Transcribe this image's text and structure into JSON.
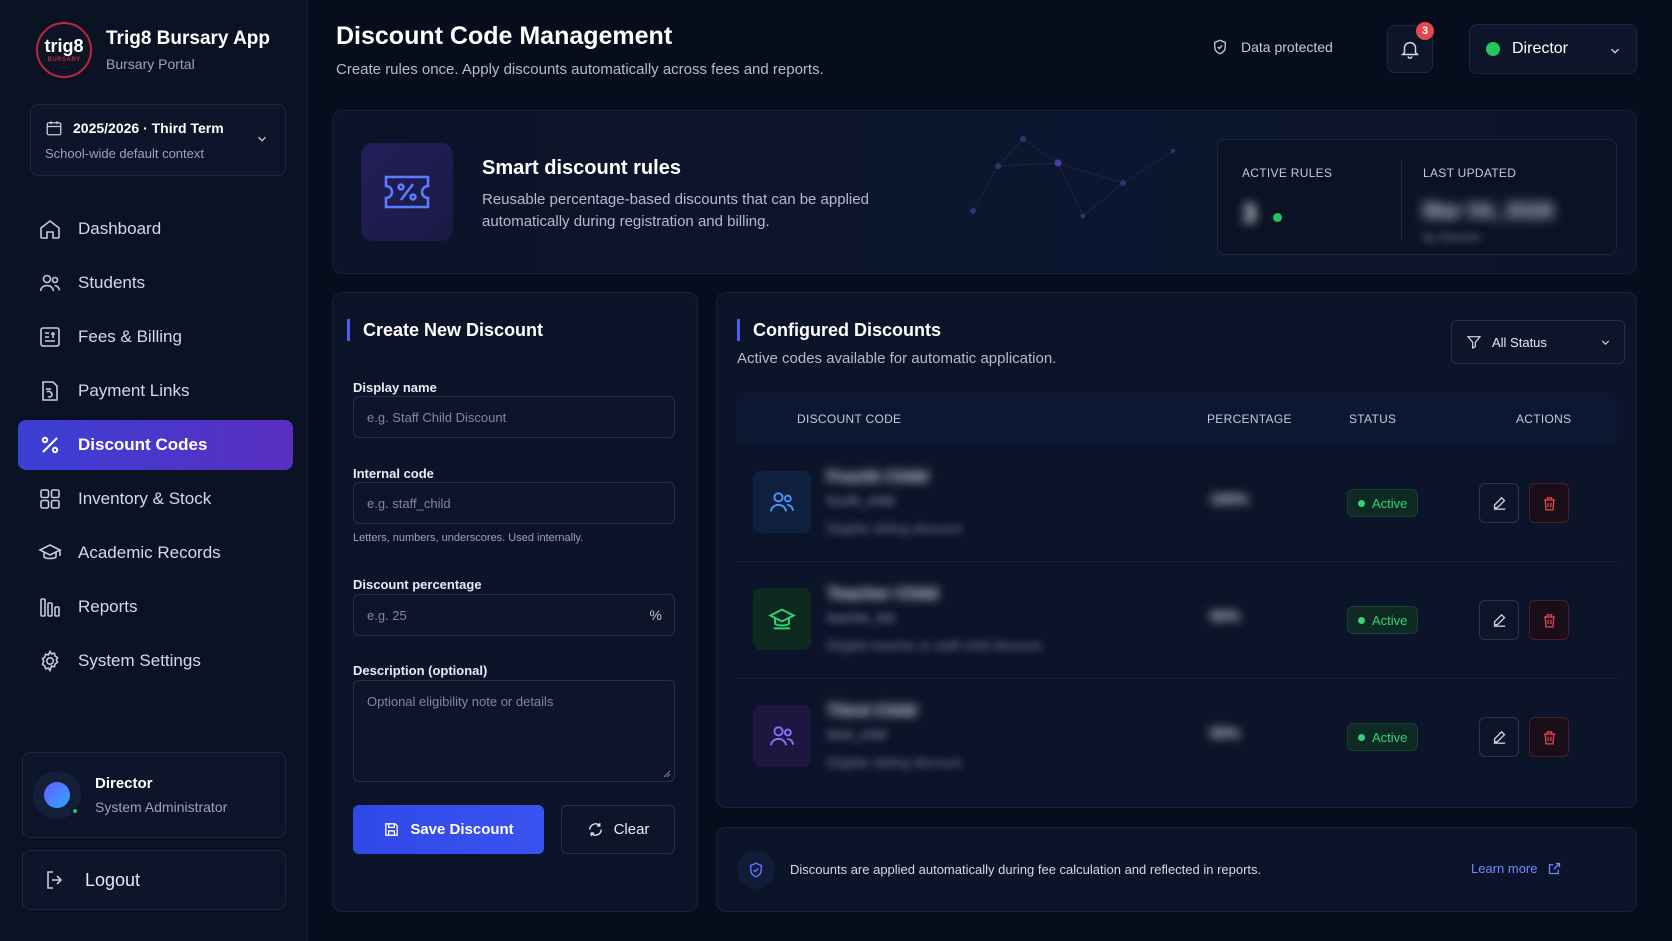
{
  "brand": {
    "logo_text": "trig8",
    "logo_sub": "BURSARY",
    "title": "Trig8 Bursary App",
    "subtitle": "Bursary Portal"
  },
  "term": {
    "title": "2025/2026 · Third Term",
    "subtitle": "School-wide default context"
  },
  "nav": {
    "items": [
      {
        "label": "Dashboard",
        "icon": "home-icon"
      },
      {
        "label": "Students",
        "icon": "users-icon"
      },
      {
        "label": "Fees & Billing",
        "icon": "receipt-icon"
      },
      {
        "label": "Payment Links",
        "icon": "link-doc-icon"
      },
      {
        "label": "Discount Codes",
        "icon": "percent-icon",
        "active": true
      },
      {
        "label": "Inventory & Stock",
        "icon": "grid-icon"
      },
      {
        "label": "Academic Records",
        "icon": "academic-icon"
      },
      {
        "label": "Reports",
        "icon": "reports-icon"
      },
      {
        "label": "System Settings",
        "icon": "gear-icon"
      }
    ]
  },
  "user": {
    "name": "Director",
    "role": "System Administrator"
  },
  "logout": {
    "label": "Logout"
  },
  "header": {
    "title": "Discount Code Management",
    "subtitle": "Create rules once. Apply discounts automatically across fees and reports.",
    "protected_label": "Data protected",
    "notification_count": "3",
    "role_label": "Director"
  },
  "hero": {
    "title": "Smart discount rules",
    "description": "Reusable percentage-based discounts that can be applied automatically during registration and billing.",
    "active_rules_label": "ACTIVE RULES",
    "active_rules_value": "3",
    "last_updated_label": "LAST UPDATED",
    "last_updated_value": "Mar 04, 2026",
    "last_updated_sub": "by Director"
  },
  "create": {
    "title": "Create New Discount",
    "display_name_label": "Display name",
    "display_name_placeholder": "e.g. Staff Child Discount",
    "internal_code_label": "Internal code",
    "internal_code_placeholder": "e.g. staff_child",
    "internal_code_hint": "Letters, numbers, underscores. Used internally.",
    "percentage_label": "Discount percentage",
    "percentage_placeholder": "e.g. 25",
    "percentage_suffix": "%",
    "description_label": "Description (optional)",
    "description_placeholder": "Optional eligibility note or details",
    "save_label": "Save Discount",
    "clear_label": "Clear"
  },
  "configured": {
    "title": "Configured Discounts",
    "subtitle": "Active codes available for automatic application.",
    "filter_label": "All Status",
    "columns": {
      "code": "DISCOUNT CODE",
      "percentage": "PERCENTAGE",
      "status": "STATUS",
      "actions": "ACTIONS"
    },
    "rows": [
      {
        "name": "Fourth Child",
        "code": "fourth_child",
        "description": "Eligible sibling discount",
        "percentage": "100%",
        "status": "Active",
        "icon": "users-icon",
        "tint": "#3b82f6"
      },
      {
        "name": "Teacher Child",
        "code": "teacher_kid",
        "description": "Eligible teacher or staff child discount",
        "percentage": "50%",
        "status": "Active",
        "icon": "graduation-cap-icon",
        "tint": "#22c55e"
      },
      {
        "name": "Third Child",
        "code": "third_child",
        "description": "Eligible sibling discount",
        "percentage": "50%",
        "status": "Active",
        "icon": "users-icon",
        "tint": "#8b5cf6"
      }
    ]
  },
  "info": {
    "text": "Discounts are applied automatically during fee calculation and reflected in reports.",
    "learn_more": "Learn more"
  },
  "colors": {
    "accent": "#3b3fd4",
    "success": "#22c55e",
    "danger": "#e5484d",
    "background": "#070d1c"
  }
}
